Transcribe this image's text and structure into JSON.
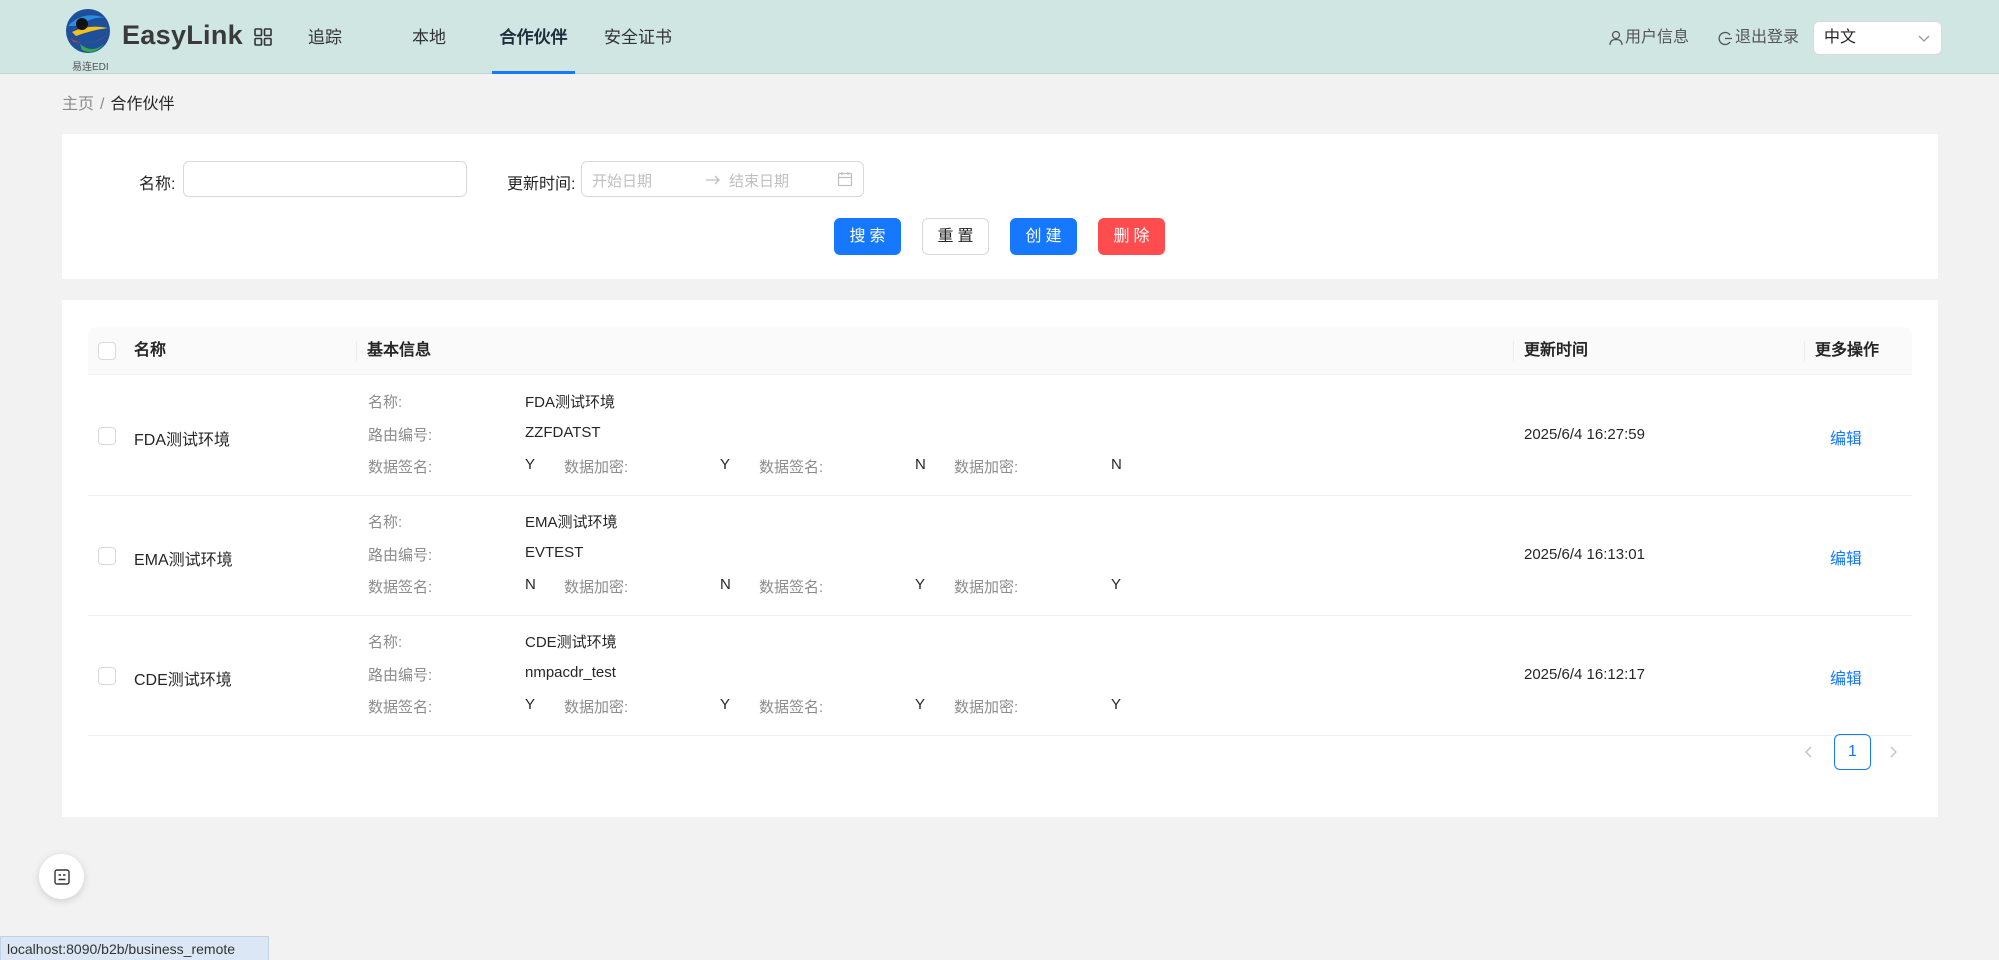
{
  "header": {
    "logo_text": "EasyLink",
    "logo_subtext": "易连EDI",
    "nav": [
      "追踪",
      "本地",
      "合作伙伴",
      "安全证书"
    ],
    "active_nav": "合作伙伴",
    "user_info": "用户信息",
    "logout": "退出登录",
    "language": "中文"
  },
  "breadcrumb": {
    "home": "主页",
    "separator": "/",
    "current": "合作伙伴"
  },
  "search": {
    "name_label": "名称:",
    "name_value": "",
    "time_label": "更新时间:",
    "start_placeholder": "开始日期",
    "end_placeholder": "结束日期",
    "buttons": {
      "search": "搜索",
      "reset": "重置",
      "create": "创建",
      "delete": "删除"
    }
  },
  "table": {
    "headers": {
      "name": "名称",
      "basic_info": "基本信息",
      "update_time": "更新时间",
      "more": "更多操作"
    },
    "info_labels": {
      "name": "名称:",
      "route": "路由编号:",
      "sign": "数据签名:",
      "encrypt": "数据加密:"
    },
    "rows": [
      {
        "name": "FDA测试环境",
        "info_name": "FDA测试环境",
        "route": "ZZFDATST",
        "sign1": "Y",
        "encrypt1": "Y",
        "sign2": "N",
        "encrypt2": "N",
        "time": "2025/6/4 16:27:59",
        "action": "编辑"
      },
      {
        "name": "EMA测试环境",
        "info_name": "EMA测试环境",
        "route": "EVTEST",
        "sign1": "N",
        "encrypt1": "N",
        "sign2": "Y",
        "encrypt2": "Y",
        "time": "2025/6/4 16:13:01",
        "action": "编辑"
      },
      {
        "name": "CDE测试环境",
        "info_name": "CDE测试环境",
        "route": "nmpacdr_test",
        "sign1": "Y",
        "encrypt1": "Y",
        "sign2": "Y",
        "encrypt2": "Y",
        "time": "2025/6/4 16:12:17",
        "action": "编辑"
      }
    ]
  },
  "pagination": {
    "current_page": "1"
  },
  "status_bar": {
    "url": "localhost:8090/b2b/business_remote"
  },
  "colors": {
    "primary": "#1677ff",
    "danger": "#ff4d4f",
    "header_bg": "#cfe6e3"
  },
  "icons": [
    "logo-icon",
    "grid-icon",
    "user-icon",
    "logout-icon",
    "chevron-down-icon",
    "calendar-icon",
    "arrow-right-icon",
    "chevron-left-icon",
    "chevron-right-icon",
    "assistant-icon"
  ]
}
